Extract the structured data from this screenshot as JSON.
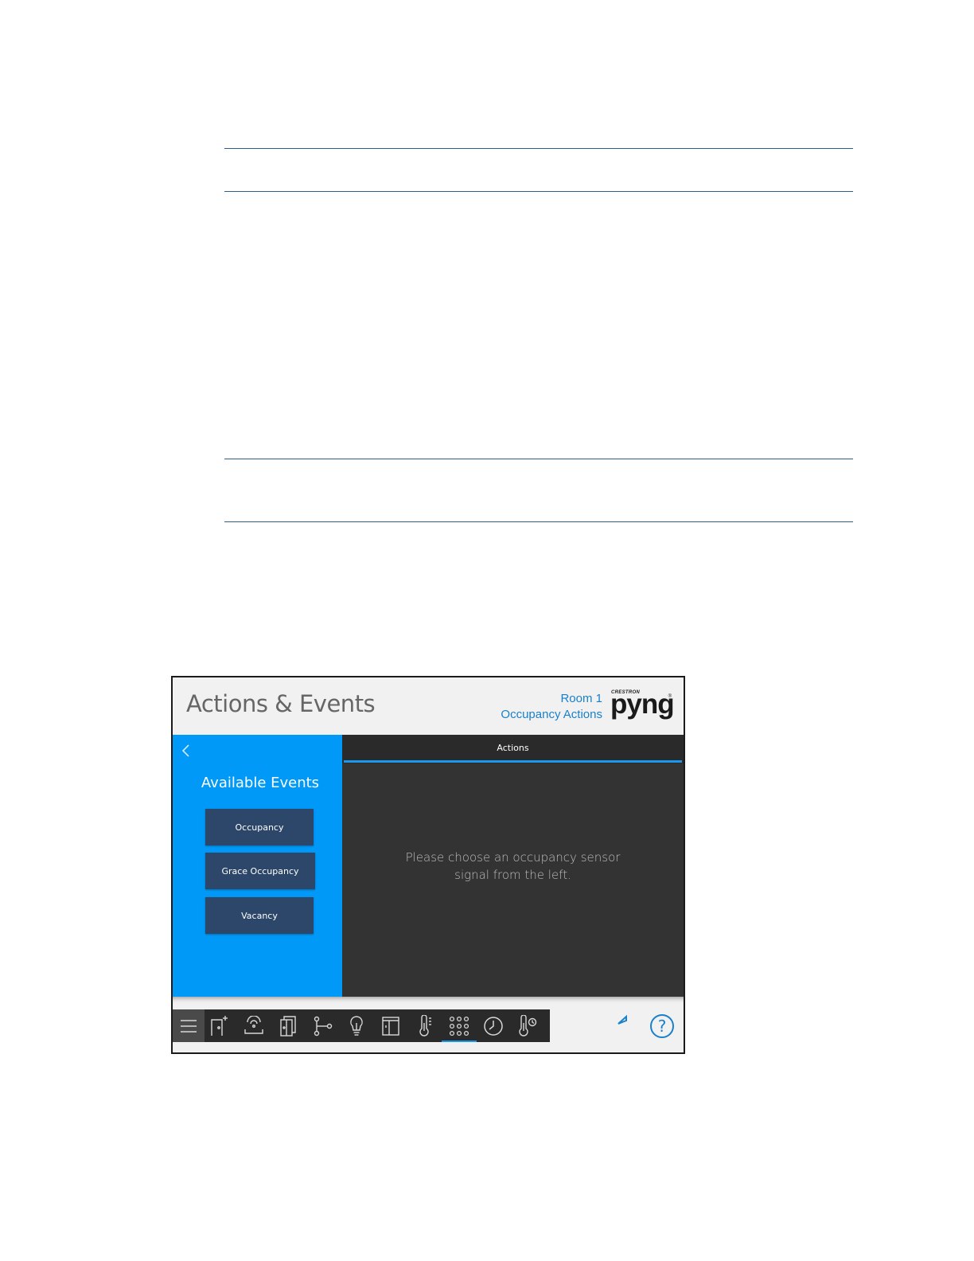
{
  "header": {
    "title": "Actions & Events",
    "room_name": "Room 1",
    "page_name": "Occupancy Actions",
    "logo_top": "CRESTRON",
    "logo_main": "pyng"
  },
  "left_panel": {
    "title": "Available Events",
    "events": [
      {
        "label": "Occupancy"
      },
      {
        "label": "Grace Occupancy"
      },
      {
        "label": "Vacancy"
      }
    ],
    "back_icon": "chevron-left-icon"
  },
  "right_panel": {
    "tab_label": "Actions",
    "message_line1": "Please choose an occupancy sensor",
    "message_line2": "signal from the left."
  },
  "bottom_nav": {
    "icons": [
      "menu-icon",
      "add-room-icon",
      "shades-icon",
      "doors-icon",
      "scenes-icon",
      "lighting-icon",
      "windows-icon",
      "thermostat-icon",
      "keypad-icon",
      "clock-icon",
      "climate-icon"
    ],
    "active_icon": "keypad-icon",
    "utility_icons": [
      "undo-icon",
      "help-icon"
    ]
  },
  "colors": {
    "accent": "#0099f7",
    "brand_text": "#1a80c9",
    "button_bg": "#2c476a",
    "dark_panel": "#333333",
    "nav_bg": "#2a2a2a",
    "active_underline": "#1a98ee"
  }
}
